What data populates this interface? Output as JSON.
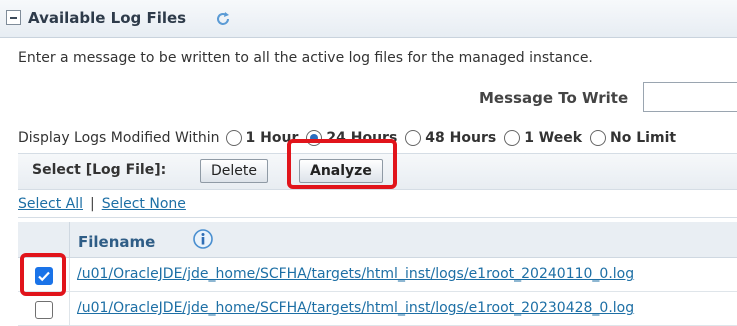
{
  "panel": {
    "title": "Available Log Files",
    "description": "Enter a message to be written to all the active log files for the managed instance."
  },
  "message": {
    "label": "Message To Write",
    "value": ""
  },
  "display_logs": {
    "label": "Display Logs Modified Within",
    "options": [
      {
        "label": "1 Hour",
        "checked": false
      },
      {
        "label": "24 Hours",
        "checked": true
      },
      {
        "label": "48 Hours",
        "checked": false
      },
      {
        "label": "1 Week",
        "checked": false
      },
      {
        "label": "No Limit",
        "checked": false
      }
    ]
  },
  "toolbar": {
    "select_label": "Select [Log File]:",
    "delete_label": "Delete",
    "analyze_label": "Analyze"
  },
  "selection": {
    "select_all": "Select All",
    "separator": "|",
    "select_none": "Select None"
  },
  "table": {
    "filename_header": "Filename",
    "rows": [
      {
        "checked": true,
        "filename": "/u01/OracleJDE/jde_home/SCFHA/targets/html_inst/logs/e1root_20240110_0.log"
      },
      {
        "checked": false,
        "filename": "/u01/OracleJDE/jde_home/SCFHA/targets/html_inst/logs/e1root_20230428_0.log"
      }
    ]
  },
  "colors": {
    "highlight": "#e1141b",
    "link": "#1d6fa5",
    "checkbox": "#1a73e8"
  }
}
